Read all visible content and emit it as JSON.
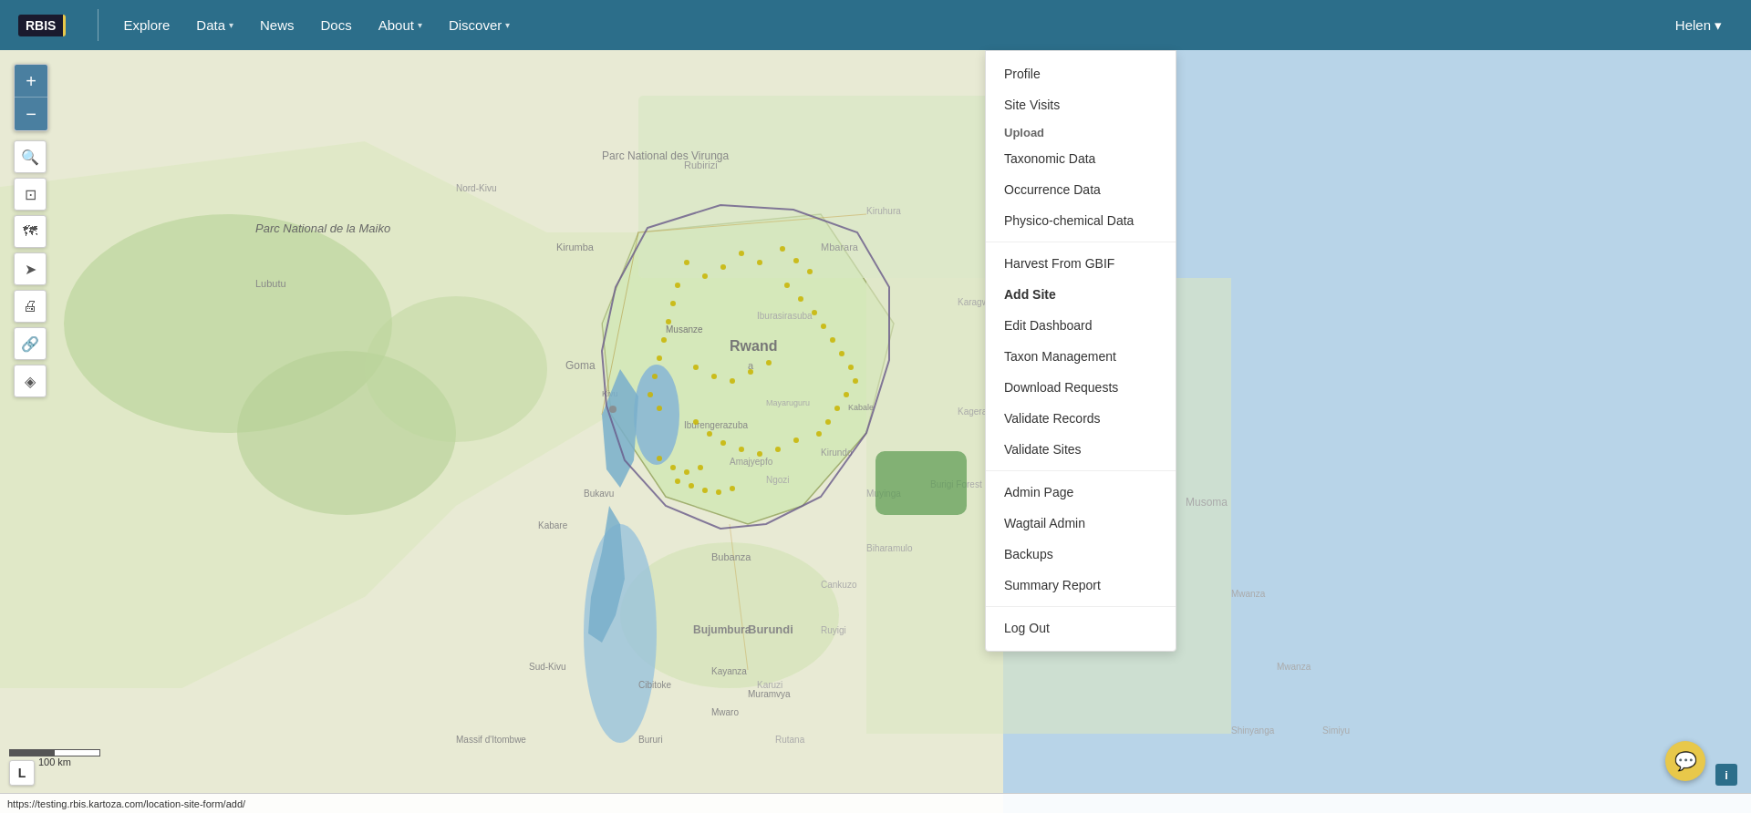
{
  "brand": {
    "logo_text": "RBIS"
  },
  "navbar": {
    "links": [
      {
        "id": "explore",
        "label": "Explore",
        "has_dropdown": false
      },
      {
        "id": "data",
        "label": "Data",
        "has_dropdown": true
      },
      {
        "id": "news",
        "label": "News",
        "has_dropdown": false
      },
      {
        "id": "docs",
        "label": "Docs",
        "has_dropdown": false
      },
      {
        "id": "about",
        "label": "About",
        "has_dropdown": true
      },
      {
        "id": "discover",
        "label": "Discover",
        "has_dropdown": true
      }
    ],
    "user": {
      "name": "Helen",
      "has_dropdown": true
    }
  },
  "map_controls": {
    "zoom_in": "+",
    "zoom_out": "−",
    "tools": [
      "🔍",
      "⊞",
      "🗺",
      "➤",
      "🖨",
      "🔗",
      "◆"
    ]
  },
  "scale": {
    "label": "100 km"
  },
  "status_bar": {
    "url": "https://testing.rbis.kartoza.com/location-site-form/add/"
  },
  "dropdown_menu": {
    "items": [
      {
        "id": "profile",
        "label": "Profile",
        "type": "link"
      },
      {
        "id": "site-visits",
        "label": "Site Visits",
        "type": "link"
      },
      {
        "id": "upload-section",
        "label": "Upload",
        "type": "section"
      },
      {
        "id": "taxonomic-data",
        "label": "Taxonomic Data",
        "type": "link"
      },
      {
        "id": "occurrence-data",
        "label": "Occurrence Data",
        "type": "link"
      },
      {
        "id": "physico-chemical-data",
        "label": "Physico-chemical Data",
        "type": "link"
      },
      {
        "id": "divider1",
        "type": "divider"
      },
      {
        "id": "harvest-gbif",
        "label": "Harvest From GBIF",
        "type": "link"
      },
      {
        "id": "add-site",
        "label": "Add Site",
        "type": "bold"
      },
      {
        "id": "edit-dashboard",
        "label": "Edit Dashboard",
        "type": "link"
      },
      {
        "id": "taxon-management",
        "label": "Taxon Management",
        "type": "link"
      },
      {
        "id": "download-requests",
        "label": "Download Requests",
        "type": "link"
      },
      {
        "id": "validate-records",
        "label": "Validate Records",
        "type": "link"
      },
      {
        "id": "validate-sites",
        "label": "Validate Sites",
        "type": "link"
      },
      {
        "id": "divider2",
        "type": "divider"
      },
      {
        "id": "admin-page",
        "label": "Admin Page",
        "type": "link"
      },
      {
        "id": "wagtail-admin",
        "label": "Wagtail Admin",
        "type": "link"
      },
      {
        "id": "backups",
        "label": "Backups",
        "type": "link"
      },
      {
        "id": "summary-report",
        "label": "Summary Report",
        "type": "link"
      },
      {
        "id": "divider3",
        "type": "divider"
      },
      {
        "id": "log-out",
        "label": "Log Out",
        "type": "link"
      }
    ]
  },
  "badges": {
    "l_badge": "L",
    "info_icon": "i",
    "chat_icon": "💬"
  }
}
